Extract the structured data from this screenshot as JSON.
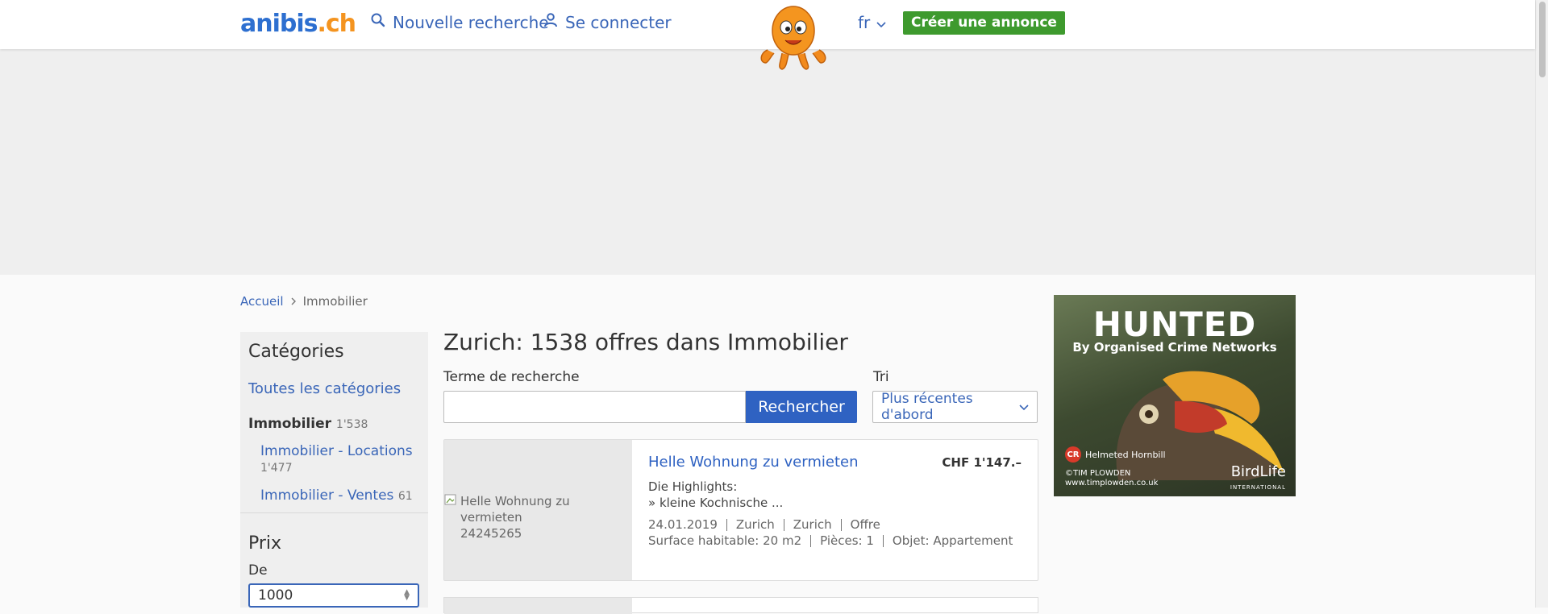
{
  "header": {
    "logo_part1": "anibis",
    "logo_part2": ".ch",
    "new_search": "Nouvelle recherche",
    "login": "Se connecter",
    "language": "fr",
    "create_ad": "Créer une annonce"
  },
  "breadcrumb": {
    "home": "Accueil",
    "current": "Immobilier"
  },
  "sidebar": {
    "title": "Catégories",
    "all_categories": "Toutes les catégories",
    "category": {
      "label": "Immobilier",
      "count": "1'538"
    },
    "subcategories": [
      {
        "label": "Immobilier - Locations",
        "count": "1'477"
      },
      {
        "label": "Immobilier - Ventes",
        "count": "61"
      }
    ],
    "price_title": "Prix",
    "price_from_label": "De",
    "price_from_value": "1000"
  },
  "main": {
    "results_title": "Zurich: 1538 offres dans Immobilier",
    "search_label": "Terme de recherche",
    "search_value": "",
    "search_button": "Rechercher",
    "sort_label": "Tri",
    "sort_value": "Plus récentes d'abord"
  },
  "listings": [
    {
      "image_alt": "Helle Wohnung zu vermieten",
      "image_id": "24245265",
      "title": "Helle Wohnung zu vermieten",
      "price": "CHF 1'147.–",
      "desc_line1": "Die Highlights:",
      "desc_line2": "» kleine Kochnische ...",
      "date": "24.01.2019",
      "location1": "Zurich",
      "location2": "Zurich",
      "type": "Offre",
      "surface": "Surface habitable: 20 m2",
      "rooms": "Pièces: 1",
      "object": "Objet: Appartement"
    }
  ],
  "ad": {
    "headline": "HUNTED",
    "subline": "By Organised Crime Networks",
    "badge": "CR",
    "species": "Helmeted Hornbill",
    "credit_line1": "©TIM PLOWDEN",
    "credit_line2": "www.timplowden.co.uk",
    "brand": "BirdLife",
    "brand_sub": "INTERNATIONAL"
  }
}
